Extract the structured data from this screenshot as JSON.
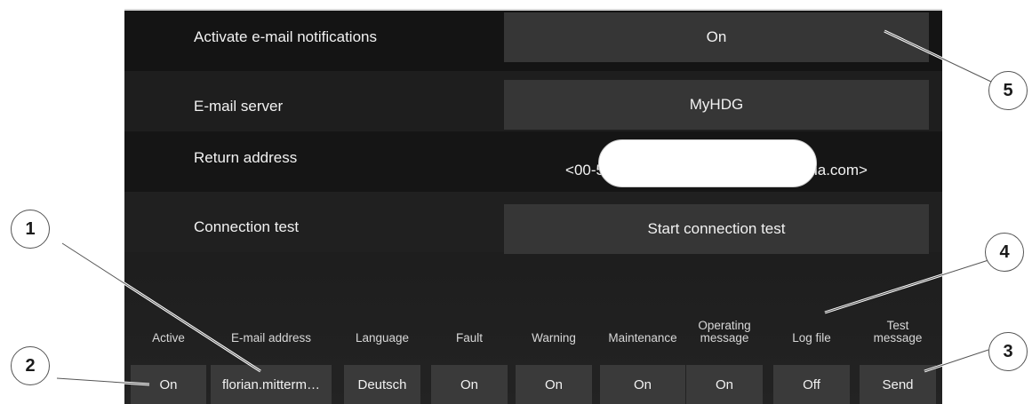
{
  "settings": {
    "rows": [
      {
        "label": "Activate e-mail notifications",
        "value": "On"
      },
      {
        "label": "E-mail server",
        "value": "MyHDG"
      },
      {
        "label": "Return address",
        "value_prefix": "<00-5",
        "value_suffix": "ia.com>"
      },
      {
        "label": "Connection test",
        "value": "Start connection test"
      }
    ]
  },
  "table": {
    "headers": [
      "Active",
      "E-mail address",
      "Language",
      "Fault",
      "Warning",
      "Maintenance",
      "Operating message",
      "Log file",
      "Test message"
    ],
    "row": [
      "On",
      "florian.mitterm…",
      "Deutsch",
      "On",
      "On",
      "On",
      "On",
      "Off",
      "Send"
    ]
  },
  "callouts": [
    "1",
    "2",
    "3",
    "4",
    "5"
  ]
}
